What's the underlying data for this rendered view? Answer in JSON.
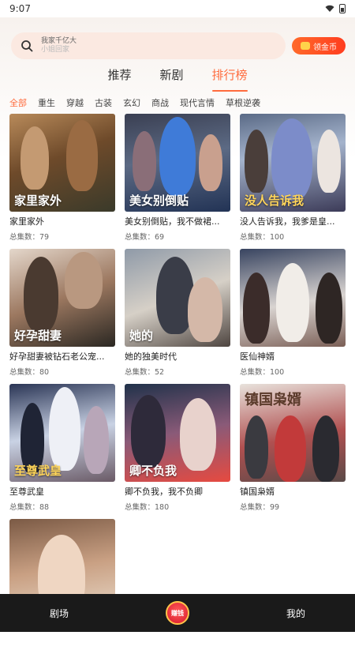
{
  "status": {
    "time": "9:07"
  },
  "search": {
    "hint_line1": "我家千亿大",
    "hint_line2": "小姐回家"
  },
  "coin_button": {
    "label": "领金币"
  },
  "main_tabs": [
    {
      "label": "推荐",
      "active": false
    },
    {
      "label": "新剧",
      "active": false
    },
    {
      "label": "排行榜",
      "active": true
    }
  ],
  "categories": [
    {
      "label": "全部",
      "active": true
    },
    {
      "label": "重生",
      "active": false
    },
    {
      "label": "穿越",
      "active": false
    },
    {
      "label": "古装",
      "active": false
    },
    {
      "label": "玄幻",
      "active": false
    },
    {
      "label": "商战",
      "active": false
    },
    {
      "label": "现代言情",
      "active": false
    },
    {
      "label": "草根逆袭",
      "active": false
    }
  ],
  "dramas": [
    {
      "title": "家里家外",
      "count": "总集数：79",
      "poster_text": "家里家外"
    },
    {
      "title": "美女别倒贴，我不做裙...",
      "count": "总集数：69",
      "poster_text": "美女别倒贴"
    },
    {
      "title": "没人告诉我，我爹是皇...",
      "count": "总集数：100",
      "poster_text": "没人告诉我"
    },
    {
      "title": "好孕甜妻被钻石老公宠...",
      "count": "总集数：80",
      "poster_text": "好孕甜妻"
    },
    {
      "title": "她的独美时代",
      "count": "总集数：52",
      "poster_text": "她的"
    },
    {
      "title": "医仙神婿",
      "count": "总集数：100",
      "poster_text": ""
    },
    {
      "title": "至尊武皇",
      "count": "总集数：88",
      "poster_text": "至尊武皇"
    },
    {
      "title": "卿不负我，我不负卿",
      "count": "总集数：180",
      "poster_text": "卿不负我"
    },
    {
      "title": "镇国枭婿",
      "count": "总集数：99",
      "poster_text": "镇国枭婿"
    },
    {
      "title": "",
      "count": "",
      "poster_text": ""
    }
  ],
  "bottom_nav": {
    "left": "剧场",
    "center": "赚钱",
    "right": "我的"
  }
}
